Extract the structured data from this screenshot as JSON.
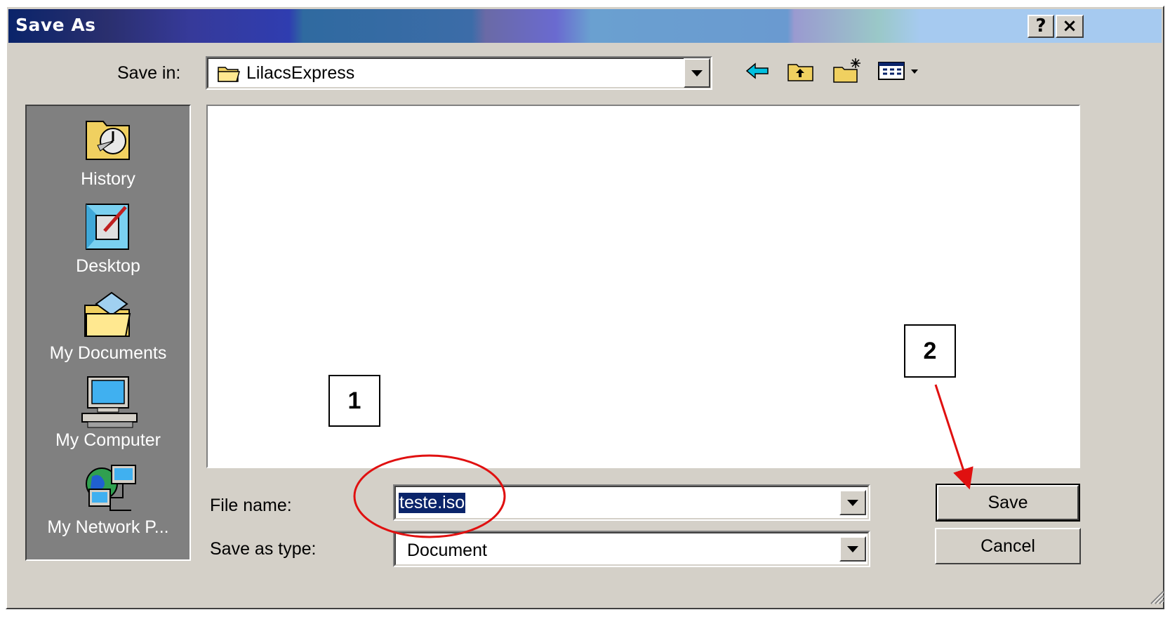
{
  "window": {
    "title": "Save As",
    "help_button": "?",
    "close_button": "×"
  },
  "toolbar": {
    "save_in_label": "Save in:",
    "save_in_value": "LilacsExpress",
    "icons": [
      "back-arrow-icon",
      "up-one-level-icon",
      "create-new-folder-icon",
      "view-menu-icon"
    ]
  },
  "places": [
    {
      "label": "History",
      "icon": "history-icon"
    },
    {
      "label": "Desktop",
      "icon": "desktop-icon"
    },
    {
      "label": "My Documents",
      "icon": "my-documents-icon"
    },
    {
      "label": "My Computer",
      "icon": "my-computer-icon"
    },
    {
      "label": "My Network P...",
      "icon": "network-places-icon"
    }
  ],
  "form": {
    "file_name_label": "File name:",
    "file_name_value": "teste.iso",
    "save_as_type_label": "Save as type:",
    "save_as_type_value": "Document"
  },
  "buttons": {
    "save": "Save",
    "cancel": "Cancel"
  },
  "annotations": {
    "callout_1": "1",
    "callout_2": "2",
    "highlight_color": "#e01010"
  },
  "colors": {
    "dialog_bg": "#d4d0c8",
    "title_dark": "#0a246a",
    "selection": "#0a246a"
  }
}
